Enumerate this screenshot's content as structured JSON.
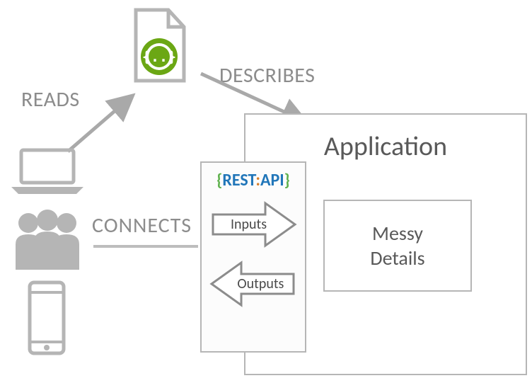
{
  "labels": {
    "reads": "READS",
    "describes": "DESCRIBES",
    "connects": "CONNECTS"
  },
  "app": {
    "title": "Application",
    "messy_l1": "Messy",
    "messy_l2": "Details"
  },
  "api": {
    "brace_open": "{",
    "rest": "REST",
    "colon": ":",
    "word_api": "API",
    "brace_close": "}",
    "inputs": "Inputs",
    "outputs": "Outputs"
  },
  "icons": {
    "document": "document-icon",
    "swagger_badge": "braces-icon",
    "laptop": "laptop-icon",
    "people": "people-icon",
    "phone": "phone-icon"
  },
  "colors": {
    "line_gray": "#a9a9a9",
    "text_gray": "#595959",
    "swagger_green": "#6ba714",
    "api_blue": "#2176b9",
    "api_brace_green": "#5fb14d",
    "api_colon_orange": "#d87f2a"
  }
}
